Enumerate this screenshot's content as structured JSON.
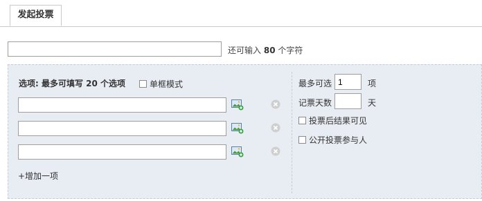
{
  "tabs": [
    {
      "label": "发起投票"
    }
  ],
  "subject": {
    "value": "",
    "hint_prefix": "还可输入",
    "remaining": "80",
    "hint_suffix": "个字符"
  },
  "options": {
    "heading": "选项: 最多可填写 20 个选项",
    "single_mode_label": "单框模式",
    "single_mode_checked": false,
    "items": [
      {
        "value": ""
      },
      {
        "value": ""
      },
      {
        "value": ""
      }
    ],
    "add_label": "+增加一项"
  },
  "settings": {
    "max_select_label": "最多可选",
    "max_select_value": "1",
    "max_select_unit": "项",
    "days_label": "记票天数",
    "days_value": "",
    "days_unit": "天",
    "show_result_label": "投票后结果可见",
    "show_result_checked": false,
    "public_voters_label": "公开投票参与人",
    "public_voters_checked": false
  },
  "icons": {
    "image": "image-upload-icon",
    "delete": "delete-circle-icon"
  },
  "colors": {
    "panel_bg": "#e8edf3",
    "panel_border": "#c2cddb",
    "tab_border": "#c9c9c9"
  }
}
